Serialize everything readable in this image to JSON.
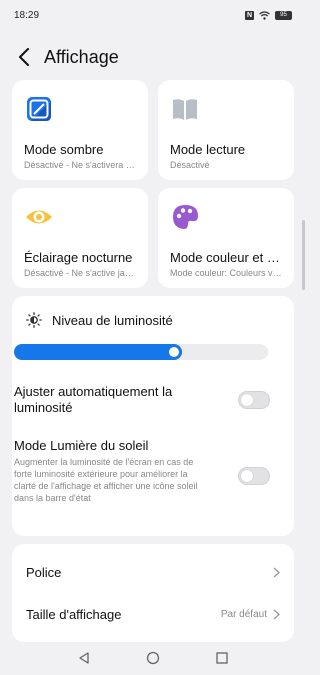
{
  "status": {
    "time": "18:29",
    "battery": "95"
  },
  "header": {
    "title": "Affichage"
  },
  "tiles": [
    {
      "title": "Mode sombre",
      "subtitle": "Désactivé - Ne s'activera jamais automatiquement",
      "icon": "dark-mode-icon"
    },
    {
      "title": "Mode lecture",
      "subtitle": "Désactivé",
      "icon": "book-icon"
    },
    {
      "title": "Éclairage nocturne",
      "subtitle": "Désactivé - Ne s'active jamais automatiquement",
      "icon": "eye-icon"
    },
    {
      "title": "Mode couleur et température",
      "subtitle": "Mode couleur: Couleurs vives",
      "icon": "palette-icon"
    }
  ],
  "brightness": {
    "label": "Niveau de luminosité",
    "level": 0.66,
    "auto_label": "Ajuster automatiquement la luminosité",
    "auto_on": false,
    "sun_label": "Mode Lumière du soleil",
    "sun_desc": "Augmenter la luminosité de l'écran en cas de forte luminosité extérieure pour améliorer la clarté de l'affichage et afficher une icône soleil dans la barre d'état",
    "sun_on": false
  },
  "list": {
    "font_label": "Police",
    "size_label": "Taille d'affichage",
    "size_value": "Par défaut"
  },
  "colors": {
    "accent": "#1677e8",
    "dark_mode": "#1a73e8",
    "book": "#b9bdc6",
    "eye": "#f5c23a",
    "palette": "#9b59d0"
  }
}
